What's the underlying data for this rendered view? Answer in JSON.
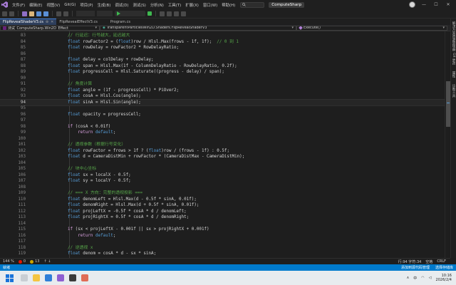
{
  "menu": {
    "items": [
      "文件(F)",
      "编辑(E)",
      "视图(V)",
      "Git(G)",
      "项目(P)",
      "生成(B)",
      "调试(D)",
      "测试(S)",
      "分析(N)",
      "工具(T)",
      "扩展(X)",
      "窗口(W)",
      "帮助(H)"
    ],
    "solution": "ComputeSharp"
  },
  "tabs": [
    {
      "label": "FlipRevealShaderV3.cs",
      "active": true
    },
    {
      "label": "FlipRevealEffectV3.cs",
      "active": false
    },
    {
      "label": "Program.cs",
      "active": false
    }
  ],
  "nav": {
    "project": "测试_ComputeSharp.Win2D_Effect",
    "type": "TransparentParticlesWin2D.Shaders.FlipRevealShaderV3",
    "member": "Execute()"
  },
  "right_panels": [
    "解决方案资源管理器",
    "Git 更改",
    "属性",
    "诊断工具"
  ],
  "editor": {
    "current_line": 94,
    "lines": [
      {
        "n": 83,
        "code": [
          [
            "c",
            "// 行延迟：行号越大，延迟越大"
          ]
        ]
      },
      {
        "n": 84,
        "code": [
          [
            "k",
            "float"
          ],
          [
            "",
            " rowFactor2 = ("
          ],
          [
            "k",
            "float"
          ],
          [
            "",
            ")row / Hlsl.Max(frows - 1f, 1f);  "
          ],
          [
            "c",
            "// 0 到 1"
          ]
        ]
      },
      {
        "n": 85,
        "code": [
          [
            "k",
            "float"
          ],
          [
            "",
            " rowDelay = rowFactor2 * RowDelayRatio;"
          ]
        ]
      },
      {
        "n": 86,
        "code": []
      },
      {
        "n": 87,
        "code": [
          [
            "k",
            "float"
          ],
          [
            "",
            " delay = colDelay + rowDelay;"
          ]
        ]
      },
      {
        "n": 88,
        "code": [
          [
            "k",
            "float"
          ],
          [
            "",
            " span = Hlsl.Max(1f - ColumnDelayRatio - RowDelayRatio, 0.2f);"
          ]
        ]
      },
      {
        "n": 89,
        "code": [
          [
            "k",
            "float"
          ],
          [
            "",
            " progressCell = Hlsl.Saturate((progress - delay) / span);"
          ]
        ]
      },
      {
        "n": 90,
        "code": []
      },
      {
        "n": 91,
        "code": [
          [
            "c",
            "// 角度计算"
          ]
        ]
      },
      {
        "n": 92,
        "code": [
          [
            "k",
            "float"
          ],
          [
            "",
            " angle = (1f - progressCell) * PiOver2;"
          ]
        ]
      },
      {
        "n": 93,
        "code": [
          [
            "k",
            "float"
          ],
          [
            "",
            " cosA = Hlsl.Cos(angle);"
          ]
        ]
      },
      {
        "n": 94,
        "code": [
          [
            "k",
            "float"
          ],
          [
            "",
            " sinA = Hlsl.Sin(angle);"
          ]
        ]
      },
      {
        "n": 95,
        "code": []
      },
      {
        "n": 96,
        "code": [
          [
            "k",
            "float"
          ],
          [
            "",
            " opacity = progressCell;"
          ]
        ]
      },
      {
        "n": 97,
        "code": []
      },
      {
        "n": 98,
        "code": [
          [
            "kc",
            "if"
          ],
          [
            "",
            " (cosA < 0.01f)"
          ]
        ]
      },
      {
        "n": 99,
        "code": [
          [
            "",
            "    "
          ],
          [
            "kc",
            "return"
          ],
          [
            "",
            " "
          ],
          [
            "k",
            "default"
          ],
          [
            "",
            ";"
          ]
        ]
      },
      {
        "n": 100,
        "code": []
      },
      {
        "n": 101,
        "code": [
          [
            "c",
            "// 透视参数（根据行号变化）"
          ]
        ]
      },
      {
        "n": 102,
        "code": [
          [
            "k",
            "float"
          ],
          [
            "",
            " rowFactor = frows > 1f ? ("
          ],
          [
            "k",
            "float"
          ],
          [
            "",
            ")row / (frows - 1f) : 0.5f;"
          ]
        ]
      },
      {
        "n": 103,
        "code": [
          [
            "k",
            "float"
          ],
          [
            "",
            " d = CameraDistMin + rowFactor * (CameraDistMax - CameraDistMin);"
          ]
        ]
      },
      {
        "n": 104,
        "code": []
      },
      {
        "n": 105,
        "code": [
          [
            "c",
            "// 块中心坐标"
          ]
        ]
      },
      {
        "n": 106,
        "code": [
          [
            "k",
            "float"
          ],
          [
            "",
            " sx = localX - 0.5f;"
          ]
        ]
      },
      {
        "n": 107,
        "code": [
          [
            "k",
            "float"
          ],
          [
            "",
            " sy = localY - 0.5f;"
          ]
        ]
      },
      {
        "n": 108,
        "code": []
      },
      {
        "n": 109,
        "code": [
          [
            "c",
            "// === X 方向：完整的透视投影 ==="
          ]
        ]
      },
      {
        "n": 110,
        "code": [
          [
            "k",
            "float"
          ],
          [
            "",
            " denomLeft = Hlsl.Max(d - 0.5f * sinA, 0.01f);"
          ]
        ]
      },
      {
        "n": 111,
        "code": [
          [
            "k",
            "float"
          ],
          [
            "",
            " denomRight = Hlsl.Max(d + 0.5f * sinA, 0.01f);"
          ]
        ]
      },
      {
        "n": 112,
        "code": [
          [
            "k",
            "float"
          ],
          [
            "",
            " projLeftX = -0.5f * cosA * d / denomLeft;"
          ]
        ]
      },
      {
        "n": 113,
        "code": [
          [
            "k",
            "float"
          ],
          [
            "",
            " projRightX = 0.5f * cosA * d / denomRight;"
          ]
        ]
      },
      {
        "n": 114,
        "code": []
      },
      {
        "n": 115,
        "code": [
          [
            "kc",
            "if"
          ],
          [
            "",
            " (sx < projLeftX - 0.001f || sx > projRightX + 0.001f)"
          ]
        ]
      },
      {
        "n": 116,
        "code": [
          [
            "",
            "    "
          ],
          [
            "kc",
            "return"
          ],
          [
            "",
            " "
          ],
          [
            "k",
            "default"
          ],
          [
            "",
            ";"
          ]
        ]
      },
      {
        "n": 117,
        "code": []
      },
      {
        "n": 118,
        "code": [
          [
            "c",
            "// 逆透视 x"
          ]
        ]
      },
      {
        "n": 119,
        "code": [
          [
            "k",
            "float"
          ],
          [
            "",
            " denom = cosA * d - sx * sinA;"
          ]
        ]
      }
    ]
  },
  "editor_status": {
    "zoom": "144 %",
    "errors": "0",
    "warnings": "13",
    "position": "行:94  字符:34",
    "encoding": "空格",
    "line_ending": "CRLF"
  },
  "statusbar": {
    "left": "就绪",
    "right_items": [
      "添加到源代码管理",
      "选择存储库"
    ]
  },
  "taskbar": {
    "time": "10:16",
    "date": "2026/2/4",
    "lang": "中"
  },
  "colors": {
    "accent": "#007acc",
    "active_tab": "#2e3f5c",
    "keyword": "#569cd6",
    "comment": "#57a64a",
    "control": "#d8a0df"
  }
}
